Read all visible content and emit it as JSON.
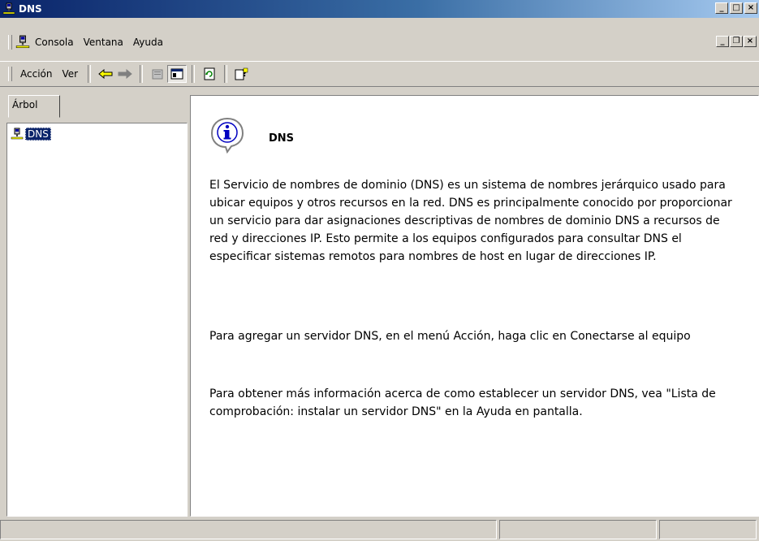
{
  "window": {
    "title": "DNS",
    "buttons": {
      "minimize": "_",
      "maximize": "□",
      "close": "×"
    }
  },
  "menubar": {
    "items": [
      {
        "label": "Consola"
      },
      {
        "label": "Ventana"
      },
      {
        "label": "Ayuda"
      }
    ],
    "mdi_buttons": {
      "minimize": "_",
      "restore": "❐",
      "close": "×"
    }
  },
  "toolbar": {
    "action_label": "Acción",
    "view_label": "Ver",
    "icons": [
      "back-arrow",
      "forward-arrow",
      "delete",
      "show-hide-tree",
      "refresh",
      "help"
    ]
  },
  "tree": {
    "tab_label": "Árbol",
    "root_label": "DNS"
  },
  "details": {
    "heading": "DNS",
    "description": "El Servicio de nombres de dominio (DNS) es un sistema de nombres jerárquico usado para ubicar equipos y otros recursos en la red. DNS es principalmente conocido por proporcionar un servicio para dar asignaciones descriptivas de nombres de dominio DNS a recursos de red y direcciones IP. Esto permite a los equipos configurados para consultar DNS el especificar sistemas remotos para nombres de host en lugar de direcciones IP.",
    "add_server": "Para agregar un servidor DNS, en el menú Acción, haga clic en Conectarse al equipo",
    "more_info": "Para obtener más información acerca de como establecer un servidor DNS, vea \"Lista de comprobación: instalar un servidor DNS\" en la Ayuda en pantalla."
  },
  "colors": {
    "title_gradient_start": "#0a246a",
    "title_gradient_end": "#a6caf0",
    "face": "#d4d0c8",
    "selection": "#0a246a"
  }
}
